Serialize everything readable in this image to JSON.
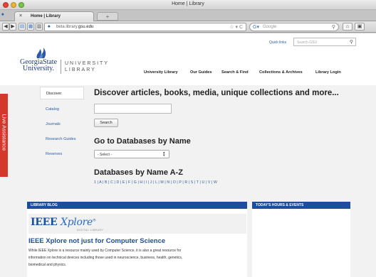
{
  "browser": {
    "window_title": "Home | Library",
    "tab_label": "Home | Library",
    "tab_close": "×",
    "newtab_label": "+",
    "back_label": "◀",
    "forward_label": "▶",
    "url_prefix": "beta.library.",
    "url_domain": "gsu.edu",
    "url_right": "☆ ▾ C",
    "search_engine_placeholder": "Google"
  },
  "header": {
    "quicklinks_label": "Quick links",
    "search_placeholder": "Search GSU",
    "logo_line1": "GeorgiaState",
    "logo_line2": "University.",
    "logo_univ_line1": "UNIVERSITY",
    "logo_univ_line2": "LIBRARY",
    "nav": [
      "University Library",
      "Our Guides",
      "Search & Find",
      "Collections & Archives",
      "Library Login"
    ]
  },
  "sidebar": {
    "items": [
      "Discover",
      "Catalog",
      "Journals",
      "Research Guides",
      "Reserves"
    ]
  },
  "live_assistance_label": "Live Assistance",
  "discover": {
    "title": "Discover articles, books, media, unique collections and more...",
    "search_button": "Search"
  },
  "databases": {
    "title": "Go to Databases by Name",
    "select_value": "- Select -",
    "az_title": "Databases by Name A-Z",
    "letters": "1 | A | B | C | D | E | F | G | H | I | J | L | M | N | O | P | R | S | T | U | V | W"
  },
  "blog": {
    "header": "LIBRARY BLOG",
    "ieee_logo_bold": "IEEE",
    "ieee_logo_italic": "Xplore",
    "ieee_logo_reg": "®",
    "ieee_sub": "DIGITAL LIBRARY",
    "post_title": "IEEE Xplore not just for Computer Science",
    "post_lines": [
      "While IEEE Xplore is a resource mainly used by Computer Science, it is also a great resource for",
      "information on technical devices including those used in neuroscience, business, health, genetics,",
      "biomedical and physics."
    ]
  },
  "hours": {
    "header": "TODAY'S HOURS & EVENTS"
  }
}
